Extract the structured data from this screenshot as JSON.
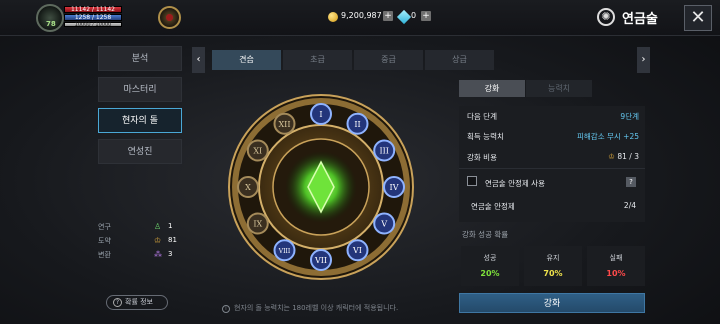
{
  "player": {
    "level": "78",
    "hp_text": "11142 / 11142",
    "mp_text": "1258 / 1258",
    "xp_text": "10000 / 10000"
  },
  "currency": {
    "gold": "9,200,987",
    "gems": "0",
    "plus": "+"
  },
  "header": {
    "title": "연금술",
    "close": "✕"
  },
  "menu": {
    "items": [
      "분석",
      "마스터리",
      "현자의 돌",
      "연성진"
    ],
    "active_index": 2
  },
  "stats": {
    "rows": [
      {
        "label": "연구",
        "value": "1"
      },
      {
        "label": "도약",
        "value": "81"
      },
      {
        "label": "변환",
        "value": "3"
      }
    ]
  },
  "prob_button": {
    "label": "확률 정보",
    "icon": "?"
  },
  "tabs": {
    "items": [
      "견습",
      "초급",
      "중급",
      "상급"
    ],
    "active_index": 0,
    "prev": "‹",
    "next": "›"
  },
  "circle": {
    "numerals": [
      "I",
      "II",
      "III",
      "IV",
      "V",
      "VI",
      "VII",
      "VIII",
      "IX",
      "X",
      "XI",
      "XII"
    ],
    "gem_color": "#5bd92f"
  },
  "footnote": {
    "icon": "i",
    "text": "현자의 돌 능력치는 180레벨 이상 캐릭터에 적용됩니다."
  },
  "right_tabs": {
    "active": "강화",
    "inactive": "능력치"
  },
  "info": {
    "next_stage_label": "다음 단계",
    "next_stage_value": "9단계",
    "ability_label": "획득 능력치",
    "ability_value": "피해감소 무시 +25",
    "cost_label": "강화 비용",
    "cost_value": "81 / 3",
    "stabilizer_use_label": "연금술 안정제 사용",
    "help": "?",
    "stabilizer_label": "연금술 안정제",
    "stabilizer_value": "2/4"
  },
  "success": {
    "title": "강화 성공 확률",
    "items": [
      {
        "label": "성공",
        "value": "20%",
        "color": "#7fe13b"
      },
      {
        "label": "유지",
        "value": "70%",
        "color": "#f0e34c"
      },
      {
        "label": "실패",
        "value": "10%",
        "color": "#ff4a4a"
      }
    ]
  },
  "enhance_button": "강화"
}
